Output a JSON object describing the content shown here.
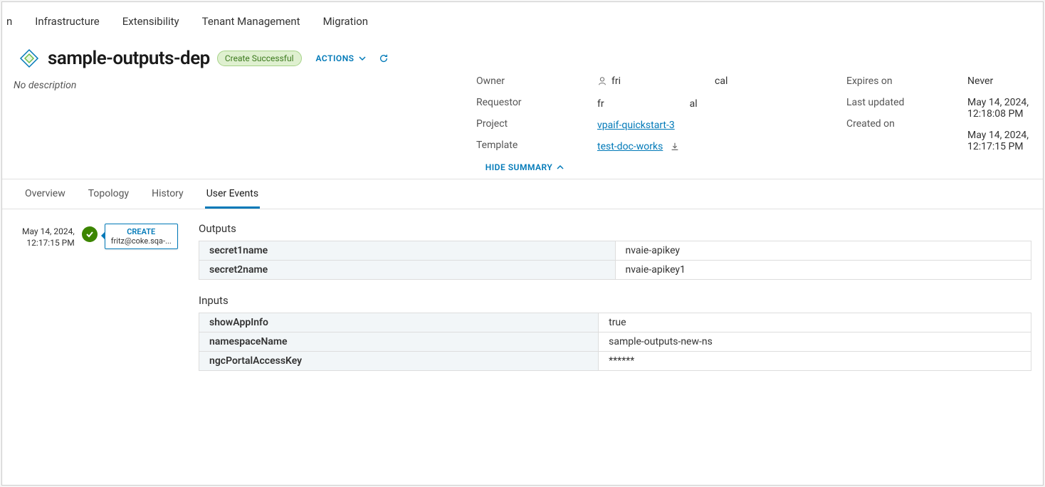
{
  "nav": {
    "items": [
      "n",
      "Infrastructure",
      "Extensibility",
      "Tenant Management",
      "Migration"
    ]
  },
  "header": {
    "title": "sample-outputs-dep",
    "status_badge": "Create Successful",
    "actions_label": "ACTIONS",
    "description": "No description"
  },
  "summary": {
    "labels": {
      "owner": "Owner",
      "requestor": "Requestor",
      "project": "Project",
      "template": "Template",
      "expires_on": "Expires on",
      "last_updated": "Last updated",
      "created_on": "Created on"
    },
    "values": {
      "owner_prefix": "fri",
      "owner_suffix": "cal",
      "requestor_prefix": "fr",
      "requestor_suffix": "al",
      "project": "vpaif-quickstart-3",
      "template": "test-doc-works",
      "expires_on": "Never",
      "last_updated": "May 14, 2024, 12:18:08 PM",
      "created_on": "May 14, 2024, 12:17:15 PM"
    },
    "hide_summary_label": "HIDE SUMMARY"
  },
  "tabs": [
    "Overview",
    "Topology",
    "History",
    "User Events"
  ],
  "active_tab": 3,
  "event": {
    "timestamp_line1": "May 14, 2024,",
    "timestamp_line2": "12:17:15 PM",
    "action": "CREATE",
    "user": "fritz@coke.sqa-..."
  },
  "details": {
    "outputs_label": "Outputs",
    "inputs_label": "Inputs",
    "outputs": [
      {
        "key": "secret1name",
        "value": "nvaie-apikey"
      },
      {
        "key": "secret2name",
        "value": "nvaie-apikey1"
      }
    ],
    "inputs": [
      {
        "key": "showAppInfo",
        "value": "true"
      },
      {
        "key": "namespaceName",
        "value": "sample-outputs-new-ns"
      },
      {
        "key": "ngcPortalAccessKey",
        "value": "******"
      }
    ]
  }
}
